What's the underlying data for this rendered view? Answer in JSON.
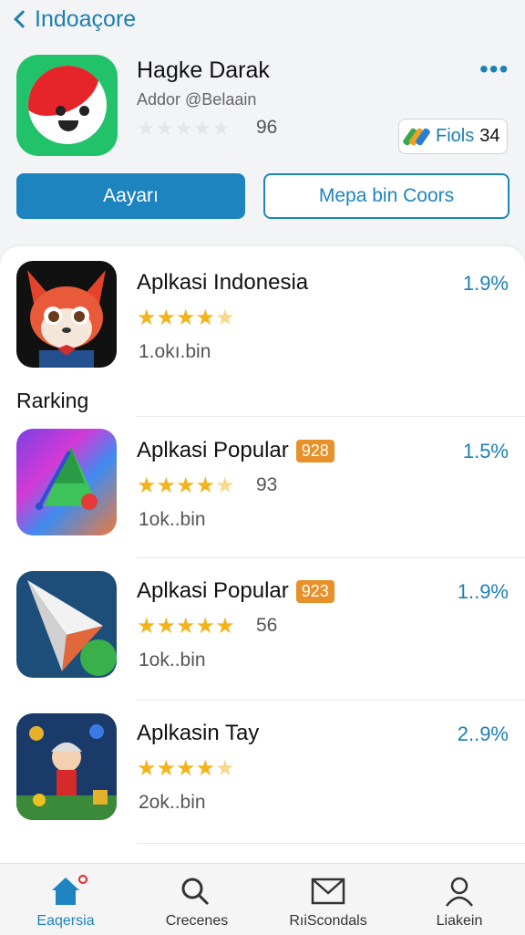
{
  "nav": {
    "back_label": "Indoaçore"
  },
  "app": {
    "title": "Hagke Darak",
    "subtitle": "Addor @Belaain",
    "stars": "★★★★★",
    "rating_count": "96",
    "fiols_label": "Fiols",
    "fiols_count": "34",
    "primary_button": "Aayarı",
    "secondary_button": "Mepa bin Coors"
  },
  "ranking_label": "Rarking",
  "list": [
    {
      "name": "Aplkasi Indonesia",
      "badge": "",
      "stars_full": "★★★★",
      "stars_half": "★",
      "rating_count": "",
      "size": "1.okı.bin",
      "percent": "1.9%"
    },
    {
      "name": "Aplkasi Popular",
      "badge": "928",
      "stars_full": "★★★★",
      "stars_half": "★",
      "rating_count": "93",
      "size": "1ok..bin",
      "percent": "1.5%"
    },
    {
      "name": "Aplkasi Popular",
      "badge": "923",
      "stars_full": "★★★★★",
      "stars_half": "",
      "rating_count": "56",
      "size": "1ok..bin",
      "percent": "1..9%"
    },
    {
      "name": "Aplkasin Tay",
      "badge": "",
      "stars_full": "★★★★",
      "stars_half": "★",
      "rating_count": "",
      "size": "2ok..bin",
      "percent": "2..9%"
    }
  ],
  "tabs": [
    {
      "label": "Eaqersia"
    },
    {
      "label": "Crecenes"
    },
    {
      "label": "RıiScondals"
    },
    {
      "label": "Liakein"
    }
  ],
  "colors": {
    "accent": "#1d84c0",
    "star": "#f3b31b",
    "badge": "#e8912a",
    "brand_green": "#22c26a",
    "brand_red": "#e5252a"
  }
}
